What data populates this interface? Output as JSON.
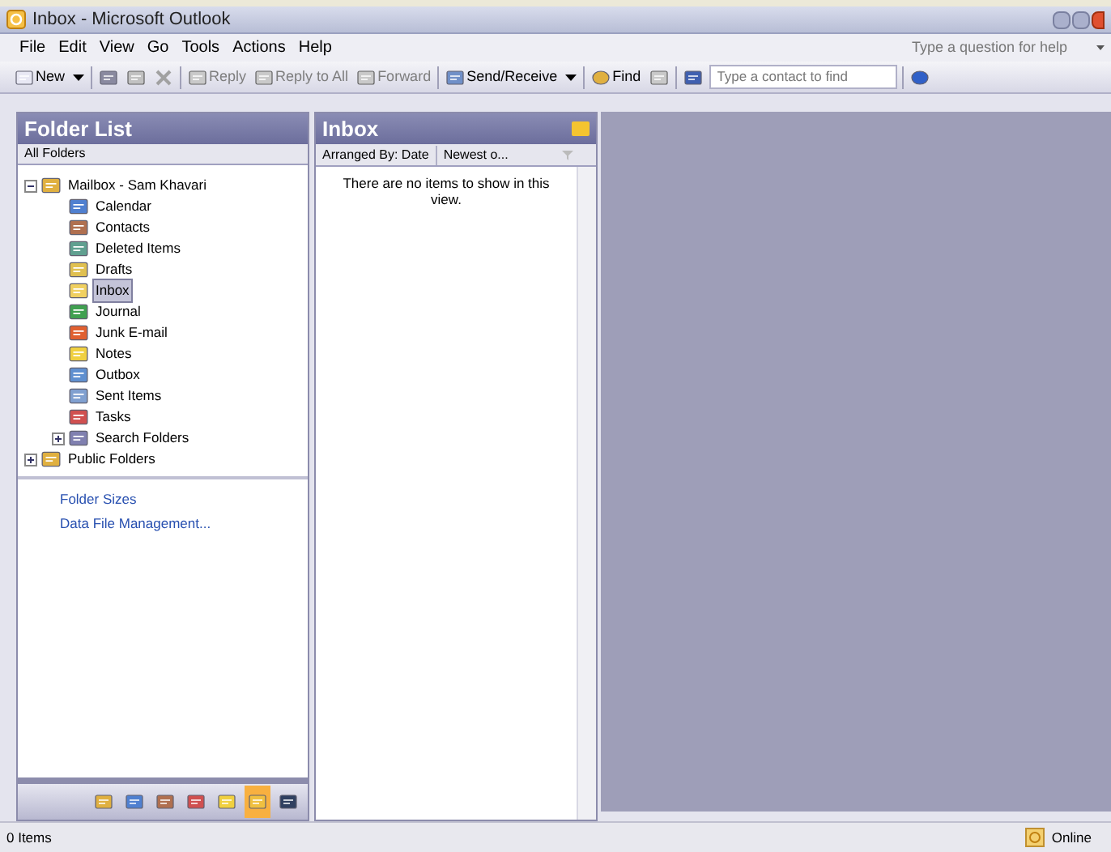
{
  "window": {
    "title": "Inbox - Microsoft Outlook"
  },
  "menu": [
    "File",
    "Edit",
    "View",
    "Go",
    "Tools",
    "Actions",
    "Help"
  ],
  "help_search": {
    "placeholder": "Type a question for help"
  },
  "toolbar": [
    {
      "kind": "button",
      "label": "New",
      "dropdown": true,
      "disabled": false
    },
    {
      "kind": "sep"
    },
    {
      "kind": "button",
      "disabled": false
    },
    {
      "kind": "button",
      "disabled": true
    },
    {
      "kind": "button",
      "disabled": true
    },
    {
      "kind": "sep"
    },
    {
      "kind": "button",
      "label": "Reply",
      "disabled": true
    },
    {
      "kind": "button",
      "label": "Reply to All",
      "disabled": true
    },
    {
      "kind": "button",
      "label": "Forward",
      "disabled": true
    },
    {
      "kind": "sep"
    },
    {
      "kind": "button",
      "label": "Send/Receive",
      "dropdown": true,
      "disabled": false
    },
    {
      "kind": "sep"
    },
    {
      "kind": "button",
      "label": "Find",
      "disabled": false
    },
    {
      "kind": "button",
      "disabled": true
    },
    {
      "kind": "sep"
    },
    {
      "kind": "button",
      "disabled": false
    },
    {
      "kind": "contact",
      "placeholder": "Type a contact to find"
    },
    {
      "kind": "sep"
    },
    {
      "kind": "button",
      "disabled": false
    }
  ],
  "folder_pane": {
    "title": "Folder List",
    "subtitle": "All Folders",
    "tree": [
      {
        "label": "Mailbox - Sam Khavari",
        "expanded": true,
        "selected": false,
        "children": [
          {
            "label": "Calendar",
            "selected": false
          },
          {
            "label": "Contacts",
            "selected": false
          },
          {
            "label": "Deleted Items",
            "selected": false
          },
          {
            "label": "Drafts",
            "selected": false
          },
          {
            "label": "Inbox",
            "selected": true
          },
          {
            "label": "Journal",
            "selected": false
          },
          {
            "label": "Junk E-mail",
            "selected": false
          },
          {
            "label": "Notes",
            "selected": false
          },
          {
            "label": "Outbox",
            "selected": false
          },
          {
            "label": "Sent Items",
            "selected": false
          },
          {
            "label": "Tasks",
            "selected": false
          },
          {
            "label": "Search Folders",
            "expanded": false,
            "selected": false
          }
        ]
      },
      {
        "label": "Public Folders",
        "expanded": false,
        "selected": false
      }
    ],
    "links": [
      "Folder Sizes",
      "Data File Management..."
    ],
    "nav_buttons": [
      {
        "selected": false
      },
      {
        "selected": false
      },
      {
        "selected": false
      },
      {
        "selected": false
      },
      {
        "selected": false
      },
      {
        "selected": true
      },
      {
        "selected": false
      }
    ]
  },
  "inbox_pane": {
    "title": "Inbox",
    "arranged_by": "Arranged By: Date",
    "sort": "Newest o...",
    "empty_message": "There are no items to show in this view."
  },
  "status_bar": {
    "items": "0 Items",
    "connection": "Online"
  }
}
